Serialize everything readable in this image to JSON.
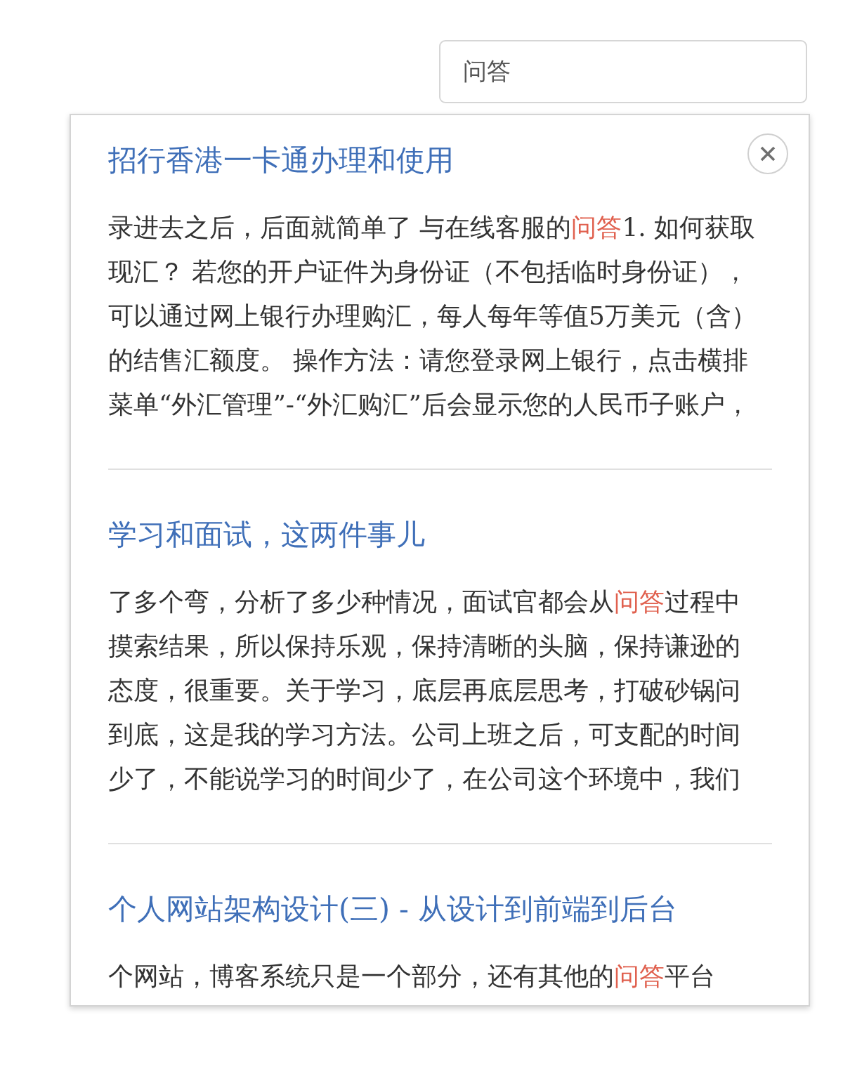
{
  "search": {
    "value": "问答"
  },
  "results": [
    {
      "title": "招行香港一卡通办理和使用",
      "snippet": [
        {
          "text": "录进去之后，后面就简单了 与在线客服的",
          "highlight": false
        },
        {
          "text": "问答",
          "highlight": true
        },
        {
          "text": "1. 如何获取现汇？ 若您的开户证件为身份证（不包括临时身份证），可以通过网上银行办理购汇，每人每年等值5万美元（含）的结售汇额度。 操作方法：请您登录网上银行，点击横排菜单“外汇管理”-“外汇购汇”后会显示您的人民币子账户，",
          "highlight": false
        }
      ]
    },
    {
      "title": "学习和面试，这两件事儿",
      "snippet": [
        {
          "text": "了多个弯，分析了多少种情况，面试官都会从",
          "highlight": false
        },
        {
          "text": "问答",
          "highlight": true
        },
        {
          "text": "过程中摸索结果，所以保持乐观，保持清晰的头脑，保持谦逊的态度，很重要。关于学习，底层再底层思考，打破砂锅问到底，这是我的学习方法。公司上班之后，可支配的时间少了，不能说学习的时间少了，在公司这个环境中，我们",
          "highlight": false
        }
      ]
    },
    {
      "title": "个人网站架构设计(三) - 从设计到前端到后台",
      "snippet": [
        {
          "text": "个网站，博客系统只是一个部分，还有其他的",
          "highlight": false
        },
        {
          "text": "问答",
          "highlight": true
        },
        {
          "text": "平台",
          "highlight": false
        }
      ]
    }
  ]
}
